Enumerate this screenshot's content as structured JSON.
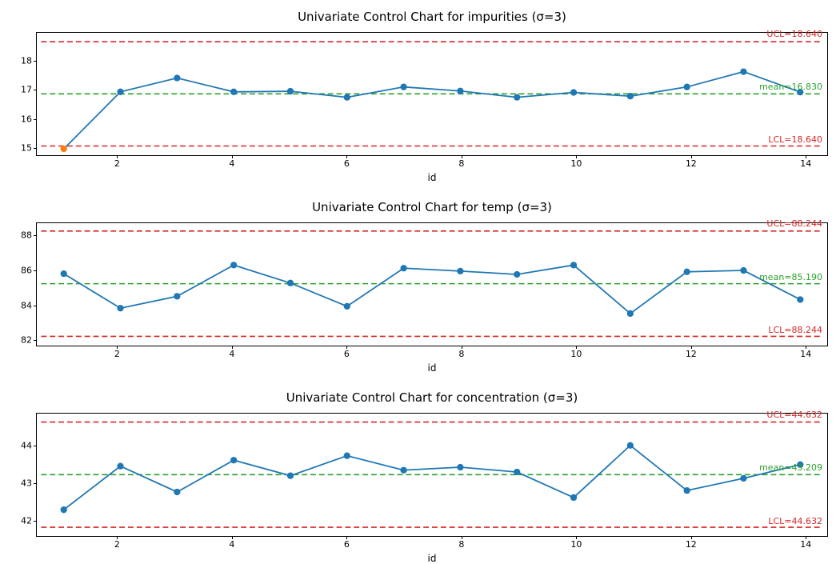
{
  "chart_data": [
    {
      "type": "line",
      "title": "Univariate Control Chart for impurities (σ=3)",
      "xlabel": "id",
      "x": [
        1,
        2,
        3,
        4,
        5,
        6,
        7,
        8,
        9,
        10,
        11,
        12,
        13,
        14
      ],
      "values": [
        14.92,
        16.9,
        17.38,
        16.9,
        16.92,
        16.71,
        17.07,
        16.93,
        16.71,
        16.88,
        16.75,
        17.07,
        17.6,
        16.89
      ],
      "outliers": [
        0
      ],
      "mean": 16.83,
      "ucl": 18.64,
      "lcl": 15.02,
      "ucl_label": "UCL=18.640",
      "lcl_label": "LCL=18.640",
      "mean_label": "mean=16.830",
      "y_ticks": [
        15,
        16,
        17,
        18
      ],
      "x_ticks": [
        2,
        4,
        6,
        8,
        10,
        12,
        14
      ],
      "ylim": [
        14.7,
        18.95
      ],
      "xlim": [
        0.6,
        14.4
      ]
    },
    {
      "type": "line",
      "title": "Univariate Control Chart for temp (σ=3)",
      "xlabel": "id",
      "x": [
        1,
        2,
        3,
        4,
        5,
        6,
        7,
        8,
        9,
        10,
        11,
        12,
        13,
        14
      ],
      "values": [
        85.77,
        83.77,
        84.46,
        86.27,
        85.23,
        83.88,
        86.09,
        85.92,
        85.73,
        86.27,
        83.46,
        85.88,
        85.96,
        84.27
      ],
      "outliers": [],
      "mean": 85.19,
      "ucl": 88.244,
      "lcl": 82.136,
      "ucl_label": "UCL=88.244",
      "lcl_label": "LCL=88.244",
      "mean_label": "mean=85.190",
      "y_ticks": [
        82,
        84,
        86,
        88
      ],
      "x_ticks": [
        2,
        4,
        6,
        8,
        10,
        12,
        14
      ],
      "ylim": [
        81.6,
        88.7
      ],
      "xlim": [
        0.6,
        14.4
      ]
    },
    {
      "type": "line",
      "title": "Univariate Control Chart for concentration (σ=3)",
      "xlabel": "id",
      "x": [
        1,
        2,
        3,
        4,
        5,
        6,
        7,
        8,
        9,
        10,
        11,
        12,
        13,
        14
      ],
      "values": [
        42.26,
        43.44,
        42.74,
        43.6,
        43.18,
        43.72,
        43.33,
        43.41,
        43.28,
        42.59,
        44.0,
        42.78,
        43.11,
        43.48
      ],
      "outliers": [],
      "mean": 43.209,
      "ucl": 44.632,
      "lcl": 41.786,
      "ucl_label": "UCL=44.632",
      "lcl_label": "LCL=44.632",
      "mean_label": "mean=43.209",
      "y_ticks": [
        42,
        43,
        44
      ],
      "x_ticks": [
        2,
        4,
        6,
        8,
        10,
        12,
        14
      ],
      "ylim": [
        41.55,
        44.86
      ],
      "xlim": [
        0.6,
        14.4
      ]
    }
  ]
}
